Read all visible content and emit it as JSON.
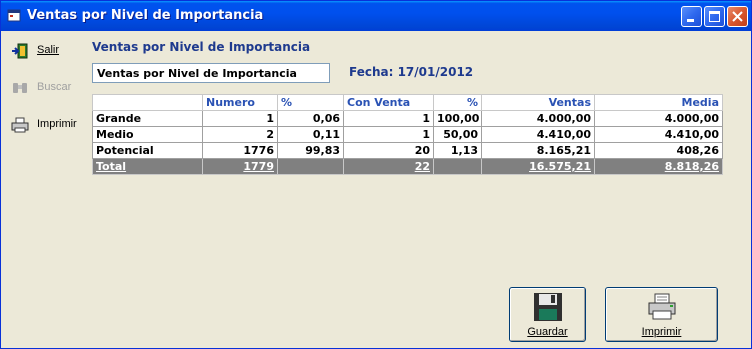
{
  "window": {
    "title": "Ventas por Nivel de Importancia"
  },
  "sidebar": {
    "items": [
      {
        "label": "Salir",
        "icon": "exit-icon",
        "enabled": true
      },
      {
        "label": "Buscar",
        "icon": "binoculars-icon",
        "enabled": false
      },
      {
        "label": "Imprimir",
        "icon": "printer-icon",
        "enabled": true
      }
    ]
  },
  "main": {
    "heading": "Ventas por Nivel de Importancia",
    "name_value": "Ventas por Nivel de Importancia",
    "fecha": "Fecha: 17/01/2012"
  },
  "table": {
    "headers": [
      "",
      "Numero",
      "%",
      "Con Venta",
      "%",
      "Ventas",
      "Media"
    ],
    "rows": [
      [
        "Grande",
        "1",
        "0,06",
        "1",
        "100,00",
        "4.000,00",
        "4.000,00"
      ],
      [
        "Medio",
        "2",
        "0,11",
        "1",
        "50,00",
        "4.410,00",
        "4.410,00"
      ],
      [
        "Potencial",
        "1776",
        "99,83",
        "20",
        "1,13",
        "8.165,21",
        "408,26"
      ]
    ],
    "total": [
      "Total",
      "1779",
      "",
      "22",
      "",
      "16.575,21",
      "8.818,26"
    ]
  },
  "buttons": {
    "guardar": "Guardar",
    "imprimir": "Imprimir"
  },
  "colors": {
    "titlebar": "#0054e3",
    "heading": "#1e3a8e",
    "header_text": "#2a52b4",
    "total_row": "#808080"
  }
}
